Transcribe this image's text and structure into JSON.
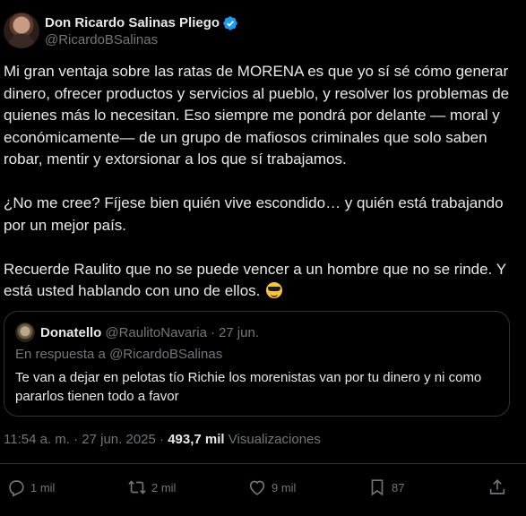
{
  "author": {
    "display_name": "Don Ricardo Salinas Pliego",
    "handle": "@RicardoBSalinas"
  },
  "tweet": {
    "paragraphs": [
      "Mi gran ventaja sobre las ratas de MORENA es que yo sí sé cómo generar dinero, ofrecer productos y servicios al pueblo, y resolver los problemas de quienes más lo necesitan. Eso siempre me pondrá por delante — moral y económicamente— de un grupo de mafiosos criminales que solo saben robar, mentir y extorsionar a los que sí trabajamos.",
      "¿No me cree? Fíjese bien quién vive escondido… y quién está trabajando por un mejor país.",
      "Recuerde Raulito que no se puede vencer a un hombre que no se rinde. Y está usted hablando con uno de ellos."
    ],
    "emoji": "smiling-face-with-sunglasses"
  },
  "quote": {
    "name": "Donatello",
    "handle": "@RaulitoNavaria",
    "dot": "·",
    "date": "27 jun.",
    "reply_prefix": "En respuesta a",
    "reply_handle": "@RicardoBSalinas",
    "text": "Te van a dejar en pelotas tío Richie los morenistas van por tu dinero y ni como pararlos tienen todo a favor"
  },
  "meta": {
    "time": "11:54 a. m.",
    "dot1": "·",
    "date": "27 jun. 2025",
    "dot2": "·",
    "views_count": "493,7 mil",
    "views_label": "Visualizaciones"
  },
  "actions": {
    "replies": "1 mil",
    "reposts": "2 mil",
    "likes": "9 mil",
    "bookmarks": "87"
  },
  "colors": {
    "background": "#000000",
    "text": "#e7e9ea",
    "secondary": "#71767b",
    "border": "#2f3336",
    "verified": "#1d9bf0"
  }
}
